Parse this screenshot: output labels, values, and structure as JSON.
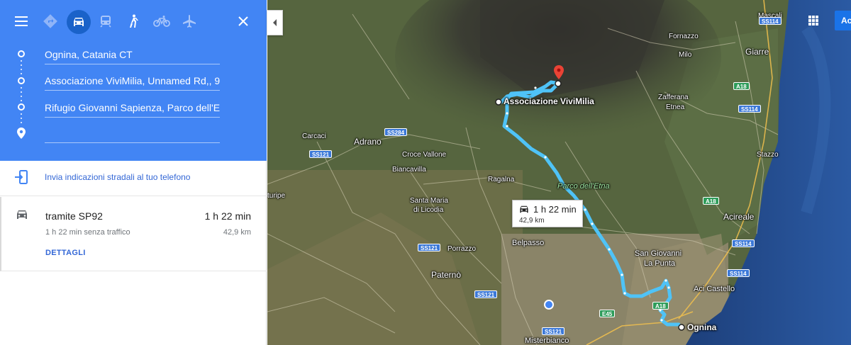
{
  "mode_bar": {
    "icons": [
      "menu-icon",
      "directions-icon",
      "car-icon",
      "transit-icon",
      "walk-icon",
      "bicycle-icon",
      "flight-icon",
      "close-icon"
    ],
    "selected_mode": "car",
    "header_color": "#4285f4"
  },
  "route": {
    "stops": [
      "Ognina, Catania CT",
      "Associazione ViviMilia, Unnamed Rd,, 9",
      "Rifugio Giovanni Sapienza, Parco dell'Et",
      ""
    ]
  },
  "send": {
    "label": "Invia indicazioni stradali al tuo telefono"
  },
  "option": {
    "via": "tramite SP92",
    "time": "1 h 22 min",
    "no_traffic": "1 h 22 min senza traffico",
    "distance": "42,9 km",
    "details": "DETTAGLI"
  },
  "map": {
    "route_color": "#4fc3f7",
    "route_box": {
      "time": "1 h 22 min",
      "distance": "42,9 km"
    },
    "poi": {
      "label": "Associazione ViviMilia"
    },
    "destination": {
      "label": "Ognina"
    },
    "signin": "Ac",
    "labels": {
      "mascali": "Mascali",
      "fornazzo": "Fornazzo",
      "milo": "Milo",
      "giarre": "Giarre",
      "zafferana": "Zafferana",
      "etnea": "Etnea",
      "carcaci": "Carcaci",
      "adrano": "Adrano",
      "croce_vallone": "Croce Vallone",
      "biancavilla": "Biancavilla",
      "ragalna": "Ragalna",
      "parco": "Parco dell'Etna",
      "stazzo": "Stazzo",
      "troina": "turipe",
      "santa_maria": "Santa Maria",
      "di_licodia": "di Licodia",
      "acireale": "Acireale",
      "porrazzo": "Porrazzo",
      "belpasso": "Belpasso",
      "san_giovanni": "San Giovanni",
      "la_punta": "La Punta",
      "paterno": "Paternò",
      "aci_castello": "Aci Castello",
      "misterbianco": "Misterbianco"
    },
    "shields": {
      "ss114_a": "SS114",
      "ss114_b": "SS114",
      "ss114_c": "SS114",
      "ss114_d": "SS114",
      "a18_a": "A18",
      "a18_b": "A18",
      "a18_c": "A18",
      "ss284": "SS284",
      "ss121_a": "SS121",
      "ss121_b": "SS121",
      "ss121_c": "SS121",
      "ss121_d": "SS121",
      "e45": "E45"
    }
  }
}
